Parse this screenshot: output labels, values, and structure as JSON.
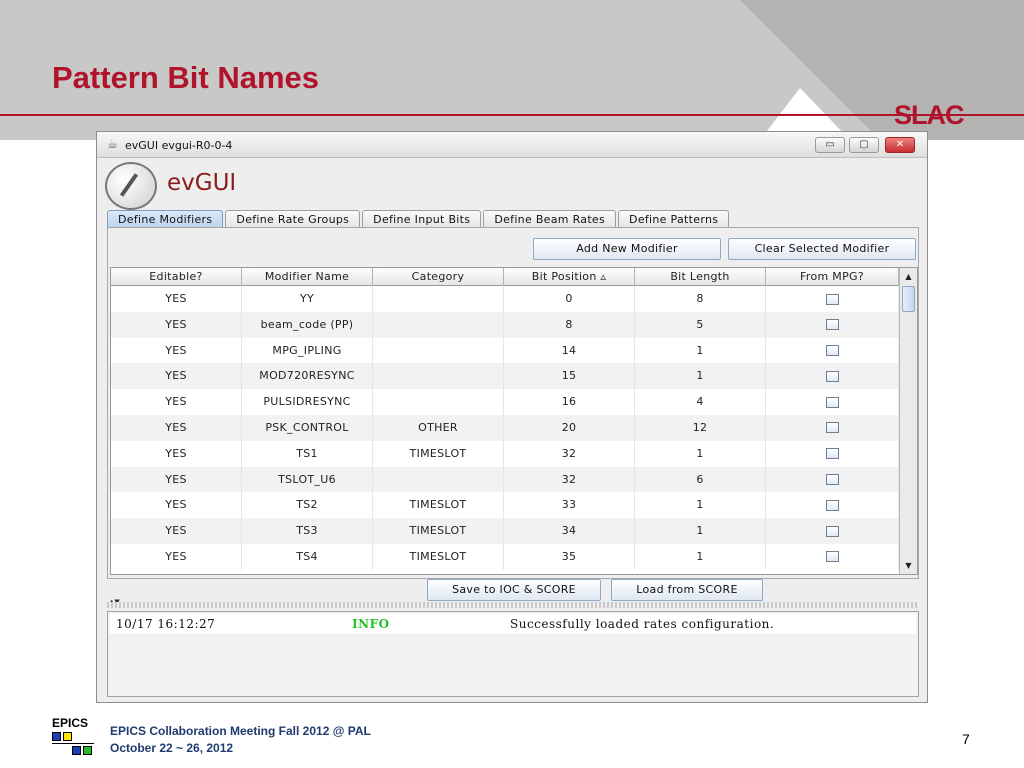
{
  "slide": {
    "title": "Pattern Bit Names",
    "org_logo": "SLAC",
    "footer_line1": "EPICS Collaboration Meeting Fall 2012 @ PAL",
    "footer_line2": "October 22 ~ 26, 2012",
    "page_number": "7",
    "epics_logo_text": "EPICS"
  },
  "window": {
    "title": "evGUI   evgui-R0-0-4",
    "app_name": "evGUI",
    "controls": {
      "minimize": "▭",
      "maximize": "▢",
      "close": "✕"
    }
  },
  "tabs": [
    {
      "label": "Define Modifiers",
      "active": true
    },
    {
      "label": "Define Rate Groups",
      "active": false
    },
    {
      "label": "Define Input Bits",
      "active": false
    },
    {
      "label": "Define Beam Rates",
      "active": false
    },
    {
      "label": "Define Patterns",
      "active": false
    }
  ],
  "toolbar": {
    "add_label": "Add New Modifier",
    "clear_label": "Clear Selected Modifier"
  },
  "table": {
    "columns": [
      "Editable?",
      "Modifier Name",
      "Category",
      "Bit Position ▵",
      "Bit Length",
      "From MPG?"
    ],
    "rows": [
      {
        "editable": "YES",
        "name": "YY",
        "category": "",
        "bit_position": "0",
        "bit_length": "8",
        "from_mpg": false
      },
      {
        "editable": "YES",
        "name": "beam_code (PP)",
        "category": "",
        "bit_position": "8",
        "bit_length": "5",
        "from_mpg": false
      },
      {
        "editable": "YES",
        "name": "MPG_IPLING",
        "category": "",
        "bit_position": "14",
        "bit_length": "1",
        "from_mpg": false
      },
      {
        "editable": "YES",
        "name": "MOD720RESYNC",
        "category": "",
        "bit_position": "15",
        "bit_length": "1",
        "from_mpg": false
      },
      {
        "editable": "YES",
        "name": "PULSIDRESYNC",
        "category": "",
        "bit_position": "16",
        "bit_length": "4",
        "from_mpg": false
      },
      {
        "editable": "YES",
        "name": "PSK_CONTROL",
        "category": "OTHER",
        "bit_position": "20",
        "bit_length": "12",
        "from_mpg": false
      },
      {
        "editable": "YES",
        "name": "TS1",
        "category": "TIMESLOT",
        "bit_position": "32",
        "bit_length": "1",
        "from_mpg": false
      },
      {
        "editable": "YES",
        "name": "TSLOT_U6",
        "category": "",
        "bit_position": "32",
        "bit_length": "6",
        "from_mpg": false
      },
      {
        "editable": "YES",
        "name": "TS2",
        "category": "TIMESLOT",
        "bit_position": "33",
        "bit_length": "1",
        "from_mpg": false
      },
      {
        "editable": "YES",
        "name": "TS3",
        "category": "TIMESLOT",
        "bit_position": "34",
        "bit_length": "1",
        "from_mpg": false
      },
      {
        "editable": "YES",
        "name": "TS4",
        "category": "TIMESLOT",
        "bit_position": "35",
        "bit_length": "1",
        "from_mpg": false
      }
    ]
  },
  "actions": {
    "save_label": "Save to IOC & SCORE",
    "load_label": "Load from SCORE"
  },
  "log": {
    "timestamp": "10/17 16:12:27",
    "level": "INFO",
    "message": "Successfully loaded rates configuration."
  },
  "colors": {
    "brand_red": "#b0142c",
    "info_green": "#22c022"
  }
}
